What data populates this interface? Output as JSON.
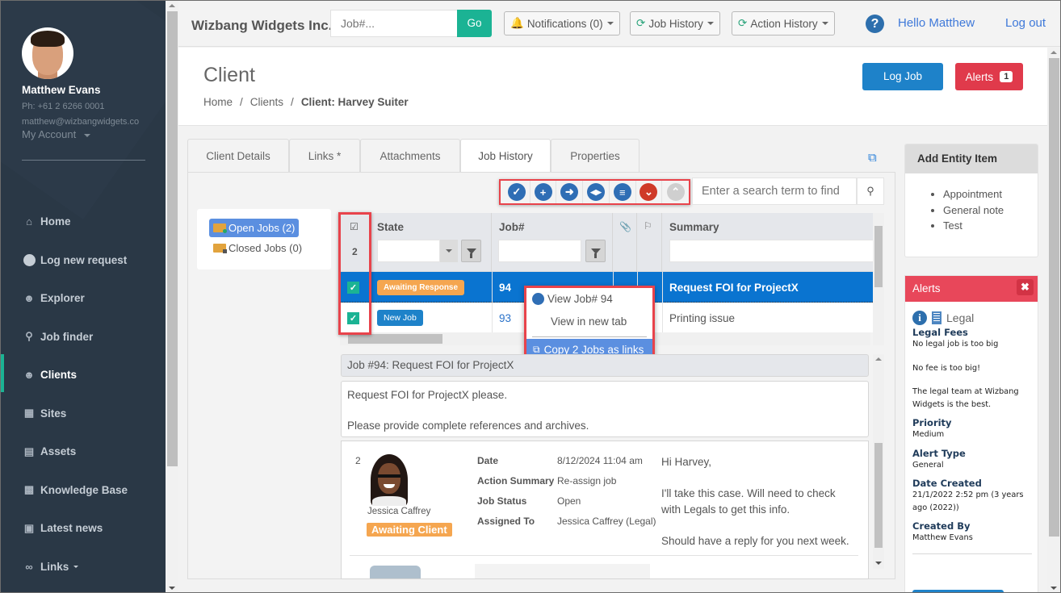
{
  "app": {
    "brand": "Wizbang Widgets Inc."
  },
  "sidebar": {
    "user": {
      "name": "Matthew Evans",
      "phone": "Ph: +61 2 6266 0001",
      "email": "matthew@wizbangwidgets.co",
      "account_label": "My Account"
    },
    "items": [
      {
        "label": "Home",
        "icon": "home-icon"
      },
      {
        "label": "Log new request",
        "icon": "circle-icon"
      },
      {
        "label": "Explorer",
        "icon": "user-desk-icon"
      },
      {
        "label": "Job finder",
        "icon": "search-icon"
      },
      {
        "label": "Clients",
        "icon": "client-icon",
        "active": true
      },
      {
        "label": "Sites",
        "icon": "building-icon"
      },
      {
        "label": "Assets",
        "icon": "barcode-icon"
      },
      {
        "label": "Knowledge Base",
        "icon": "book-gear-icon"
      },
      {
        "label": "Latest news",
        "icon": "newspaper-icon"
      },
      {
        "label": "Links",
        "icon": "link-icon",
        "has_dropdown": true
      }
    ]
  },
  "topbar": {
    "job_search_placeholder": "Job#...",
    "go_label": "Go",
    "notifications_label": "Notifications (0)",
    "job_history_label": "Job History",
    "action_history_label": "Action History",
    "help_label": "?",
    "greeting": "Hello Matthew",
    "logout_label": "Log out"
  },
  "header": {
    "title": "Client",
    "breadcrumb": [
      "Home",
      "Clients",
      "Client: Harvey Suiter"
    ],
    "log_job_label": "Log Job",
    "alerts_label": "Alerts",
    "alerts_count": "1"
  },
  "tabs": [
    {
      "label": "Client Details"
    },
    {
      "label": "Links *"
    },
    {
      "label": "Attachments"
    },
    {
      "label": "Job History",
      "active": true
    },
    {
      "label": "Properties"
    }
  ],
  "toolbar": {
    "buttons": [
      "check-icon",
      "plus-icon",
      "arrow-right-icon",
      "split-icon",
      "list-icon",
      "chevron-down-icon",
      "chevron-up-icon"
    ],
    "search_placeholder": "Enter a search term to find"
  },
  "folders": [
    {
      "label": "Open Jobs (2)",
      "active": true
    },
    {
      "label": "Closed Jobs (0)"
    }
  ],
  "grid": {
    "selected_count": "2",
    "columns": {
      "state": "State",
      "job": "Job#",
      "summary": "Summary"
    },
    "rows": [
      {
        "checked": true,
        "state": "Awaiting Response",
        "state_color": "#f5a650",
        "job": "94",
        "summary": "Request FOI for ProjectX",
        "selected": true
      },
      {
        "checked": true,
        "state": "New Job",
        "state_color": "#1e82c9",
        "job": "93",
        "summary": "Printing issue",
        "selected": false
      }
    ]
  },
  "context_menu": {
    "view_job": "View Job# 94",
    "view_new_tab": "View in new tab",
    "copy_links": "Copy 2 Jobs as links"
  },
  "detail": {
    "title": "Job #94: Request FOI for ProjectX",
    "body_line1": "Request FOI for ProjectX please.",
    "body_line2": "Please provide complete references and archives."
  },
  "action": {
    "number": "2",
    "person": "Jessica Caffrey",
    "status": "Awaiting Client",
    "fields": [
      {
        "label": "Date",
        "value": "8/12/2024 11:04 am"
      },
      {
        "label": "Action Summary",
        "value": "Re-assign job"
      },
      {
        "label": "Job Status",
        "value": "Open"
      },
      {
        "label": "Assigned To",
        "value": "Jessica Caffrey (Legal)"
      }
    ],
    "message": [
      "Hi Harvey,",
      "I'll take this case. Will need to check with Legals to get this info.",
      "Should have a reply for you next week."
    ]
  },
  "entity_panel": {
    "title": "Add Entity Item",
    "items": [
      "Appointment",
      "General note",
      "Test"
    ]
  },
  "alerts_panel": {
    "title": "Alerts",
    "category": "Legal",
    "alert_title": "Legal Fees",
    "desc1": "No legal job is too big",
    "desc2": "No fee is too big!",
    "desc3": "The legal team at Wizbang Widgets is the best.",
    "priority_label": "Priority",
    "priority": "Medium",
    "type_label": "Alert Type",
    "type": "General",
    "created_label": "Date Created",
    "created": "21/1/2022 2:52 pm (3 years ago (2022))",
    "by_label": "Created By",
    "by": "Matthew Evans"
  },
  "colors": {
    "accent": "#1bb394",
    "primary": "#1e82c9",
    "danger": "#e03a4b",
    "highlight": "#e8434b",
    "selected_row": "#0a74d0"
  }
}
